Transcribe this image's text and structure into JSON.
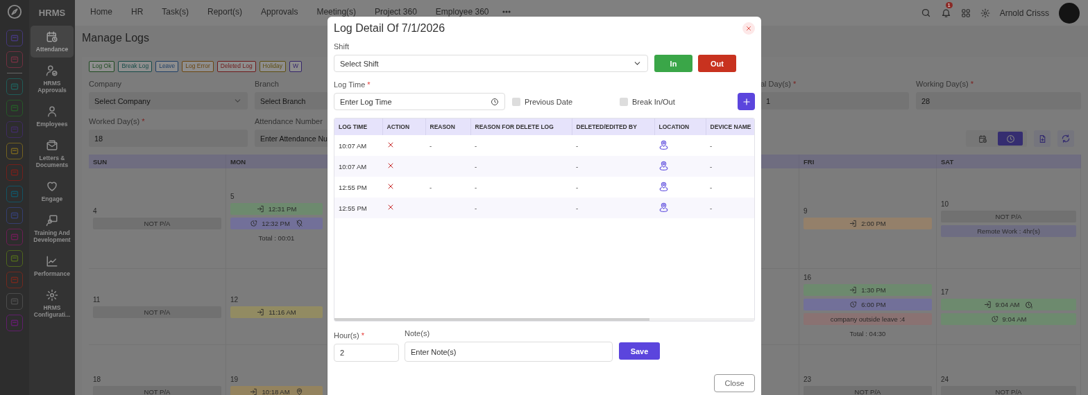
{
  "sidebar": {
    "brand": "HRMS",
    "items": [
      {
        "label": "Attendance",
        "selected": true
      },
      {
        "label": "HRMS Approvals",
        "selected": false
      },
      {
        "label": "Employees",
        "selected": false
      },
      {
        "label": "Letters & Documents",
        "selected": false
      },
      {
        "label": "Engage",
        "selected": false
      },
      {
        "label": "Training And Development",
        "selected": false
      },
      {
        "label": "Performance",
        "selected": false
      },
      {
        "label": "HRMS Configurati...",
        "selected": false
      }
    ]
  },
  "top_nav": {
    "items": [
      "Home",
      "HR",
      "Task(s)",
      "Report(s)",
      "Approvals",
      "Meeting(s)",
      "Project 360",
      "Employee 360"
    ],
    "notification_count": "1",
    "user_name": "Arnold Crisss"
  },
  "page": {
    "title": "Manage Logs",
    "legend": [
      {
        "label": "Log Ok",
        "color": "#1f4a21"
      },
      {
        "label": "Break Log",
        "color": "#164a47"
      },
      {
        "label": "Leave",
        "color": "#1f3f66"
      },
      {
        "label": "Log Error",
        "color": "#6a4510"
      },
      {
        "label": "Deleted Log",
        "color": "#6e1a1a"
      },
      {
        "label": "Holiday",
        "color": "#5e4e10"
      },
      {
        "label": "W",
        "color": "#35266a"
      }
    ],
    "left_fields": [
      {
        "kind": "select",
        "label": "Company",
        "placeholder": "Select Company"
      },
      {
        "kind": "select",
        "label": "Branch",
        "placeholder": "Select Branch"
      },
      {
        "kind": "input",
        "label": "Worked Day(s)",
        "required_mark": "*",
        "value": "18"
      },
      {
        "kind": "input",
        "label": "Attendance Number",
        "placeholder": "Enter Attendance Nu"
      }
    ],
    "right_fields": [
      {
        "kind": "input",
        "label": "al Day(s)",
        "required_mark": "*",
        "value": "1"
      },
      {
        "kind": "input",
        "label": "Working Day(s)",
        "required_mark": "*",
        "value": "28"
      }
    ],
    "view_toggle": [
      {
        "selected": false
      },
      {
        "selected": true
      }
    ],
    "calendar": {
      "headers": [
        "SUN",
        "MON",
        "FRI",
        "SAT"
      ],
      "weeks": [
        {
          "days": [
            {
              "date": "4",
              "entries": [
                {
                  "kind": "na",
                  "text": "NOT P/A"
                }
              ]
            },
            {
              "date": "5",
              "entries": [
                {
                  "kind": "in",
                  "color": "#6d8a6e",
                  "text": "12:31 PM"
                },
                {
                  "kind": "out",
                  "color": "#727099",
                  "text": "12:32 PM",
                  "geotag": false
                },
                {
                  "kind": "total",
                  "text": "Total : 00:01"
                }
              ]
            },
            {
              "date": "9",
              "entries": [
                {
                  "kind": "in",
                  "color": "#94806a",
                  "text": "2:00 PM"
                }
              ]
            },
            {
              "date": "10",
              "entries": [
                {
                  "kind": "na",
                  "text": "NOT P/A"
                },
                {
                  "kind": "remote",
                  "text": "Remote Work : 4hr(s)"
                }
              ]
            }
          ]
        },
        {
          "days": [
            {
              "date": "11",
              "entries": [
                {
                  "kind": "na",
                  "text": "NOT P/A"
                }
              ]
            },
            {
              "date": "12",
              "entries": [
                {
                  "kind": "in",
                  "color": "#928b62",
                  "text": "11:16 AM"
                }
              ]
            },
            {
              "date": "16",
              "entries": [
                {
                  "kind": "in",
                  "color": "#6d8a6e",
                  "text": "1:30 PM"
                },
                {
                  "kind": "out",
                  "color": "#727099",
                  "text": "6:00 PM"
                },
                {
                  "kind": "leave",
                  "text": "company outside leave :4"
                },
                {
                  "kind": "total",
                  "text": "Total : 04:30"
                }
              ]
            },
            {
              "date": "17",
              "entries": [
                {
                  "kind": "in",
                  "color": "#6d8a6e",
                  "text": "9:04 AM",
                  "alert": true
                },
                {
                  "kind": "out",
                  "color": "#6d8a6e",
                  "text": "9:04 AM"
                }
              ]
            }
          ]
        },
        {
          "days": [
            {
              "date": "18",
              "entries": [
                {
                  "kind": "na",
                  "text": "NOT P/A"
                }
              ]
            },
            {
              "date": "19",
              "entries": [
                {
                  "kind": "in",
                  "color": "#94835e",
                  "text": "10:18 AM",
                  "geotag": true
                }
              ]
            },
            {
              "date": "23",
              "entries": [
                {
                  "kind": "na",
                  "text": "NOT P/A"
                }
              ]
            },
            {
              "date": "24",
              "entries": [
                {
                  "kind": "na",
                  "text": "NOT P/A"
                }
              ]
            }
          ]
        }
      ]
    }
  },
  "modal": {
    "title": "Log Detail Of 7/1/2026",
    "shift": {
      "label": "Shift",
      "placeholder": "Select Shift"
    },
    "in_button": "In",
    "out_button": "Out",
    "log_time": {
      "label": "Log Time",
      "required_mark": "*",
      "placeholder": "Enter Log Time"
    },
    "options": [
      {
        "label": "Previous Date",
        "checked": false
      },
      {
        "label": "Break In/Out",
        "checked": false
      }
    ],
    "table": {
      "columns": [
        "LOG TIME",
        "ACTION",
        "REASON",
        "REASON FOR DELETE LOG",
        "DELETED/EDITED BY",
        "LOCATION",
        "DEVICE NAME"
      ],
      "rows": [
        {
          "log_time": "10:07 AM",
          "reason": "-",
          "delete_reason": "-",
          "edited_by": "-",
          "device_name": "-"
        },
        {
          "log_time": "10:07 AM",
          "delete_reason": "-",
          "edited_by": "-",
          "device_name": "-"
        },
        {
          "log_time": "12:55 PM",
          "reason": "-",
          "delete_reason": "-",
          "edited_by": "-",
          "device_name": "-"
        },
        {
          "log_time": "12:55 PM",
          "delete_reason": "-",
          "edited_by": "-",
          "device_name": "-"
        }
      ]
    },
    "hours": {
      "label": "Hour(s)",
      "required_mark": "*",
      "value": "2"
    },
    "notes": {
      "label": "Note(s)",
      "placeholder": "Enter Note(s)"
    },
    "save_button": "Save",
    "close_button": "Close"
  }
}
